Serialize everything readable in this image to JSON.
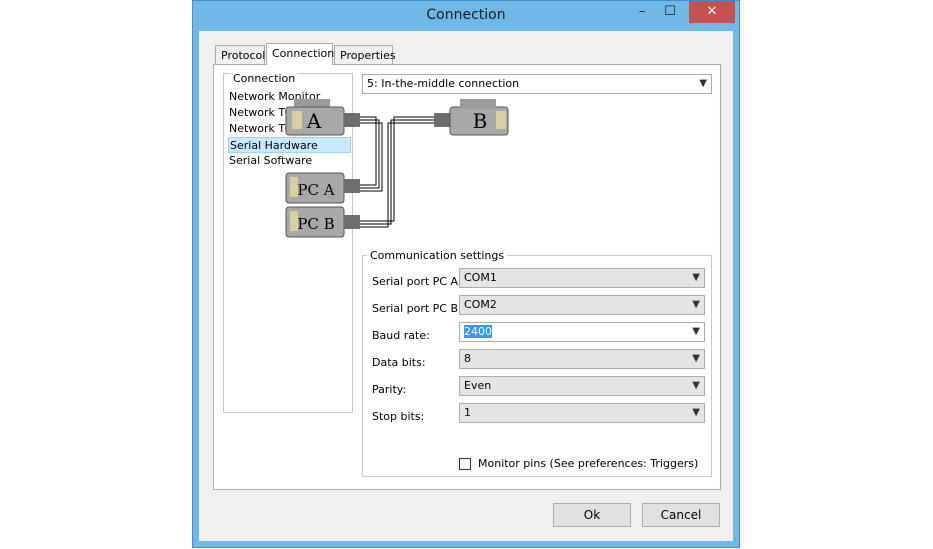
{
  "window": {
    "title": "Connection",
    "minimize": "–",
    "maximize": "☐",
    "close": "✕"
  },
  "tabs": [
    {
      "label": "Protocol"
    },
    {
      "label": "Connection"
    },
    {
      "label": "Properties"
    }
  ],
  "connection_list": {
    "legend": "Connection",
    "items": [
      "Network Monitor",
      "Network TCP Client",
      "Network TCP Server",
      "Serial Hardware",
      "Serial Software"
    ],
    "selected": "Serial Hardware"
  },
  "connection_mode": {
    "value": "5: In-the-middle connection"
  },
  "diagram": {
    "a": "A",
    "b": "B",
    "pc_a": "PC A",
    "pc_b": "PC B"
  },
  "comm": {
    "legend": "Communication settings",
    "serial_a": {
      "label": "Serial port PC A:",
      "value": "COM1"
    },
    "serial_b": {
      "label": "Serial port PC B:",
      "value": "COM2"
    },
    "baud": {
      "label": "Baud rate:",
      "value": "2400"
    },
    "data_bits": {
      "label": "Data bits:",
      "value": "8"
    },
    "parity": {
      "label": "Parity:",
      "value": "Even"
    },
    "stop_bits": {
      "label": "Stop bits:",
      "value": "1"
    },
    "monitor_pins": {
      "label": "Monitor pins (See preferences: Triggers)",
      "checked": false
    }
  },
  "buttons": {
    "ok": "Ok",
    "cancel": "Cancel"
  },
  "icons": {
    "dropdown": "chevron-down-icon"
  },
  "colors": {
    "title_bar": "#6fb8e8",
    "close": "#c75050",
    "selection": "#cce8ff"
  }
}
